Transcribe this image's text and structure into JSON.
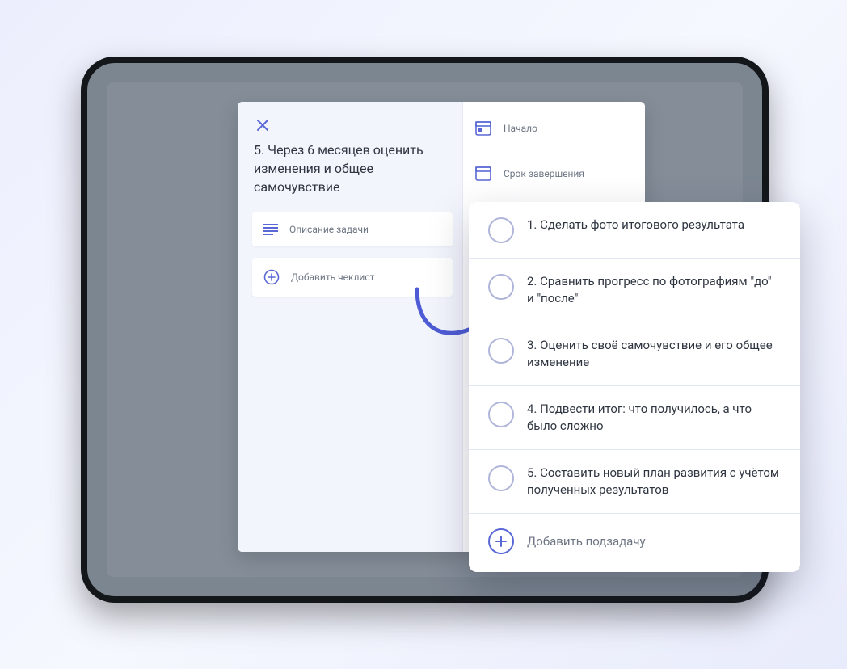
{
  "task": {
    "title": "5. Через 6 месяцев оценить изменения и общее самочувствие",
    "description_placeholder": "Описание задачи",
    "add_checklist_label": "Добавить чеклист"
  },
  "meta": {
    "start_label": "Начало",
    "due_label": "Срок завершения"
  },
  "subtasks": {
    "items": [
      "1. Сделать фото итогового результата",
      "2. Сравнить прогресс по фотографиям \"до\" и \"после\"",
      "3. Оценить своё самочувствие и его общее изменение",
      "4. Подвести итог: что получилось, а что было сложно",
      "5. Составить новый план развития с учётом полученных результатов"
    ],
    "add_label": "Добавить подзадачу"
  },
  "colors": {
    "accent": "#5a68d6",
    "muted": "#6e7684",
    "ring": "#b0b5d9"
  }
}
